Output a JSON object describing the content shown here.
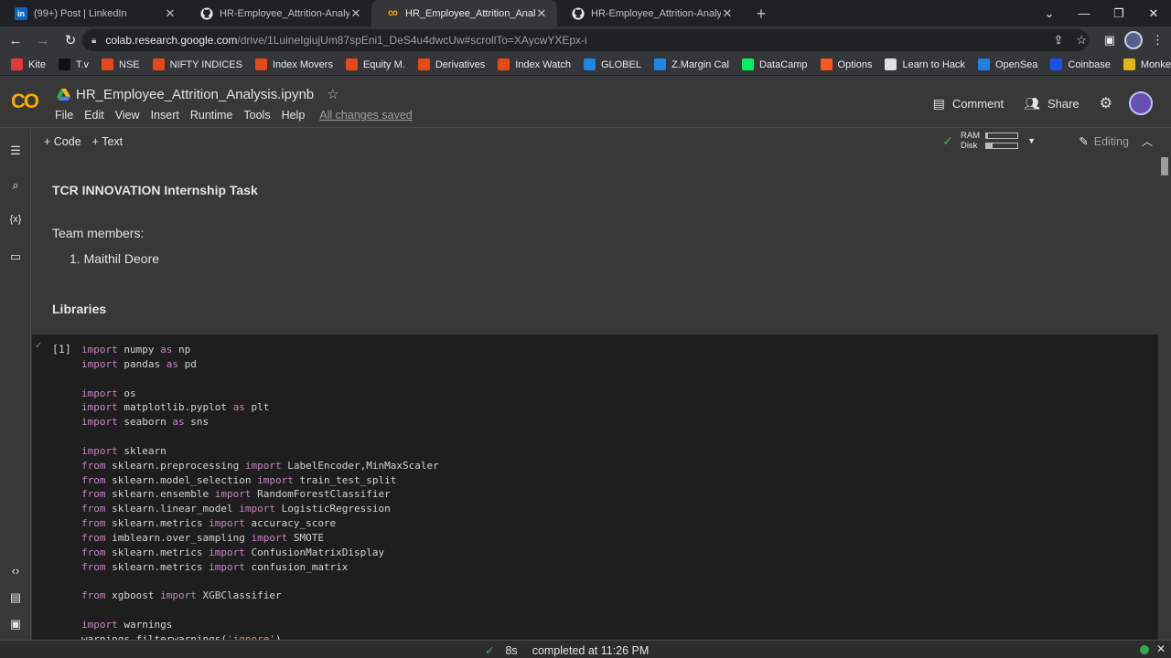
{
  "browser": {
    "tabs": [
      {
        "title": "(99+) Post | LinkedIn",
        "icon": "linkedin-icon",
        "active": false
      },
      {
        "title": "HR-Employee_Attrition-Analysis/",
        "icon": "github-icon",
        "active": false
      },
      {
        "title": "HR_Employee_Attrition_Analysis.i",
        "icon": "colab-icon",
        "active": true
      },
      {
        "title": "HR-Employee_Attrition-Analysis/",
        "icon": "github-icon",
        "active": false
      }
    ],
    "url_host": "colab.research.google.com",
    "url_path": "/drive/1LuineIgiujUm87spEni1_DeS4u4dwcUw#scrollTo=XAycwYXEpx-i",
    "bookmarks": [
      {
        "label": "Kite",
        "color": "#e53935"
      },
      {
        "label": "T.v",
        "color": "#111111"
      },
      {
        "label": "NSE",
        "color": "#e64a19"
      },
      {
        "label": "NIFTY INDICES",
        "color": "#e64a19"
      },
      {
        "label": "Index Movers",
        "color": "#e64a19"
      },
      {
        "label": "Equity M.",
        "color": "#e64a19"
      },
      {
        "label": "Derivatives",
        "color": "#e64a19"
      },
      {
        "label": "Index Watch",
        "color": "#e64a19"
      },
      {
        "label": "GLOBEL",
        "color": "#1e88e5"
      },
      {
        "label": "Z.Margin Cal",
        "color": "#1e88e5"
      },
      {
        "label": "DataCamp",
        "color": "#03ef62"
      },
      {
        "label": "Options",
        "color": "#ff5722"
      },
      {
        "label": "Learn to Hack",
        "color": "#e0e0e0"
      },
      {
        "label": "OpenSea",
        "color": "#2081e2"
      },
      {
        "label": "Coinbase",
        "color": "#1652f0"
      },
      {
        "label": "Monkeytype",
        "color": "#e2b714"
      }
    ]
  },
  "colab": {
    "logo": "CO",
    "notebook_title": "HR_Employee_Attrition_Analysis.ipynb",
    "menu": [
      "File",
      "Edit",
      "View",
      "Insert",
      "Runtime",
      "Tools",
      "Help"
    ],
    "saved_status": "All changes saved",
    "comment_label": "Comment",
    "share_label": "Share",
    "add_code_label": "+ Code",
    "add_text_label": "+ Text",
    "ram_label": "RAM",
    "disk_label": "Disk",
    "ram_usage": 0.05,
    "disk_usage": 0.2,
    "editing_label": "Editing"
  },
  "notebook": {
    "heading1": "TCR INNOVATION Internship Task",
    "team_label": "Team members:",
    "team_member": "1. Maithil Deore",
    "heading2": "Libraries",
    "cell_count": "[1]"
  },
  "status": {
    "duration": "8s",
    "completed": "completed at 11:26 PM"
  }
}
